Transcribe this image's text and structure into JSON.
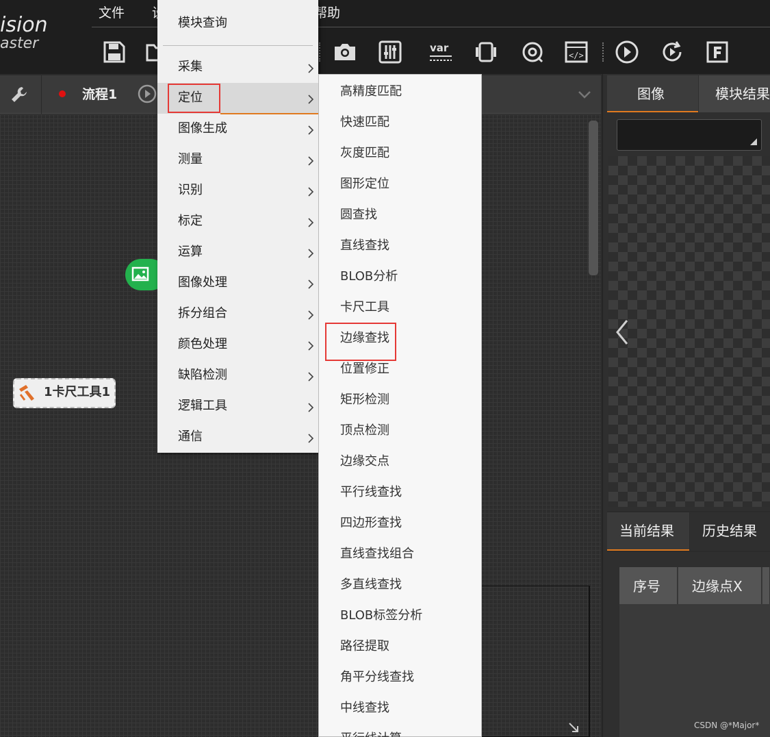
{
  "logo": {
    "line1": "ision",
    "line2": "aster"
  },
  "menubar": {
    "file": "文件",
    "partial": "设",
    "help": "帮助"
  },
  "process": {
    "title": "流程1"
  },
  "canvas": {
    "caliper_node_label": "1卡尺工具1"
  },
  "context_menu": {
    "query": "模块查询",
    "items": [
      "采集",
      "定位",
      "图像生成",
      "测量",
      "识别",
      "标定",
      "运算",
      "图像处理",
      "拆分组合",
      "颜色处理",
      "缺陷检测",
      "逻辑工具",
      "通信"
    ],
    "active_item": "定位"
  },
  "sub_menu": {
    "items": [
      "高精度匹配",
      "快速匹配",
      "灰度匹配",
      "图形定位",
      "圆查找",
      "直线查找",
      "BLOB分析",
      "卡尺工具",
      "边缘查找",
      "位置修正",
      "矩形检测",
      "顶点检测",
      "边缘交点",
      "平行线查找",
      "四边形查找",
      "直线查找组合",
      "多直线查找",
      "BLOB标签分析",
      "路径提取",
      "角平分线查找",
      "中线查找",
      "平行线计算"
    ],
    "highlighted_item": "边缘查找"
  },
  "right_panel": {
    "tabs": [
      "图像",
      "模块结果"
    ],
    "result_tabs": [
      "当前结果",
      "历史结果"
    ],
    "table_headers": [
      "序号",
      "边缘点X"
    ]
  },
  "watermark": "CSDN @*Major*",
  "colors": {
    "accent": "#e07a1f",
    "highlight_box": "#e53935",
    "node_green": "#23b14d"
  },
  "icons": {
    "toolbar": [
      "save-icon",
      "open-folder-icon",
      "camera-icon",
      "sliders-icon",
      "variable-icon",
      "device-icon",
      "target-refresh-icon",
      "code-icon",
      "play-icon",
      "loop-play-icon",
      "f-icon"
    ]
  }
}
